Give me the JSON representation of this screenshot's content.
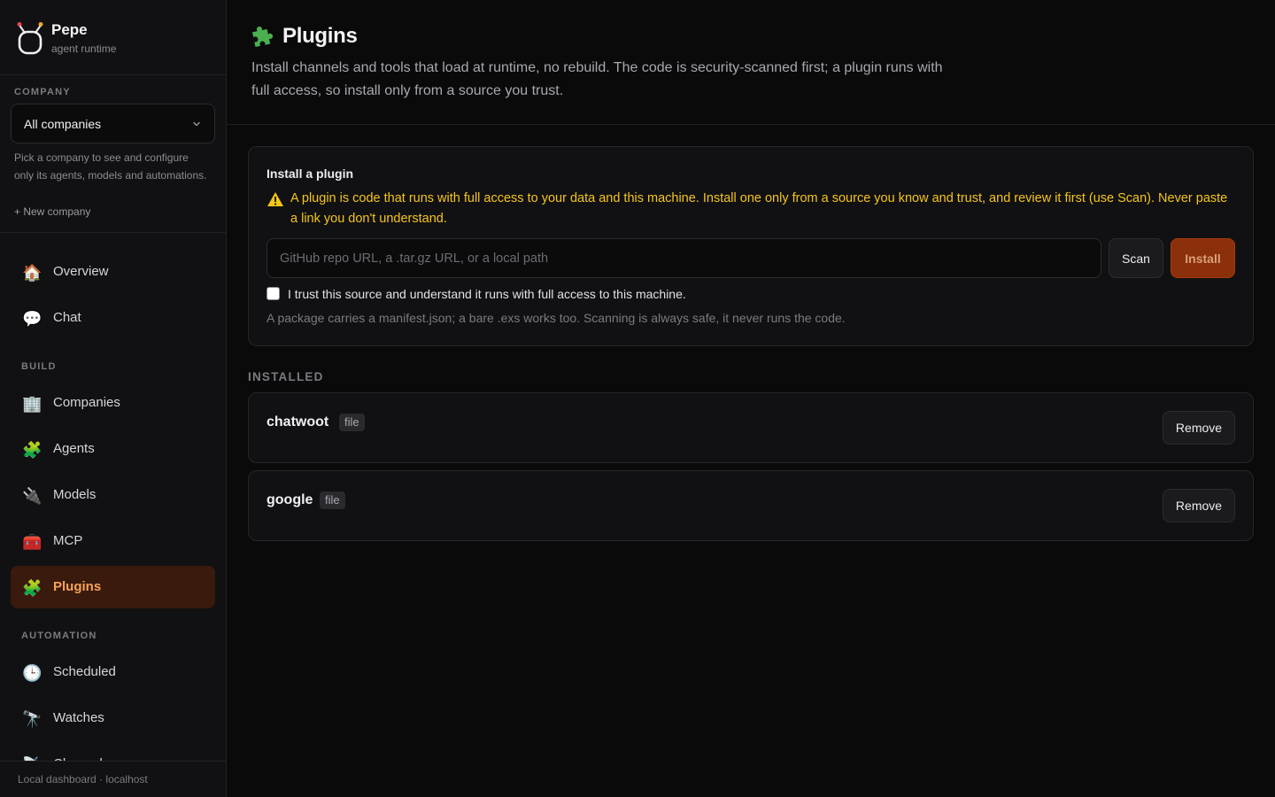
{
  "brand": {
    "name": "Pepe",
    "subtitle": "agent runtime",
    "icon": "tomato-logo-icon"
  },
  "company": {
    "section_label": "COMPANY",
    "selected": "All companies",
    "help": "Pick a company to see and configure only its agents, models and automations.",
    "new_company": "+ New company"
  },
  "nav": {
    "top": [
      {
        "label": "Overview",
        "icon": "house-icon",
        "glyph": "🏠"
      },
      {
        "label": "Chat",
        "icon": "speech-bubble-icon",
        "glyph": "💬"
      }
    ],
    "build_label": "BUILD",
    "build": [
      {
        "label": "Companies",
        "icon": "office-building-icon",
        "glyph": "🏢"
      },
      {
        "label": "Agents",
        "icon": "puzzle-piece-icon",
        "glyph": "🧩"
      },
      {
        "label": "Models",
        "icon": "plug-icon",
        "glyph": "🔌"
      },
      {
        "label": "MCP",
        "icon": "toolbox-icon",
        "glyph": "🧰"
      },
      {
        "label": "Plugins",
        "icon": "puzzle-piece-icon",
        "glyph": "🧩",
        "active": true
      }
    ],
    "automation_label": "AUTOMATION",
    "automation": [
      {
        "label": "Scheduled",
        "icon": "clock-icon",
        "glyph": "🕒"
      },
      {
        "label": "Watches",
        "icon": "telescope-icon",
        "glyph": "🔭"
      },
      {
        "label": "Channels",
        "icon": "satellite-icon",
        "glyph": "📡"
      }
    ]
  },
  "footer": {
    "text": "Local dashboard · localhost"
  },
  "page": {
    "title": "Plugins",
    "title_icon": "puzzle-piece-icon",
    "description": "Install channels and tools that load at runtime, no rebuild. The code is security-scanned first; a plugin runs with full access, so install only from a source you trust."
  },
  "install": {
    "title": "Install a plugin",
    "warning": "A plugin is code that runs with full access to your data and this machine. Install one only from a source you know and trust, and review it first (use Scan). Never paste a link you don't understand.",
    "input_value": "",
    "input_placeholder": "GitHub repo URL, a .tar.gz URL, or a local path",
    "scan_label": "Scan",
    "install_label": "Install",
    "trust_label": "I trust this source and understand it runs with full access to this machine.",
    "trust_checked": false,
    "help": "A package carries a manifest.json; a bare .exs works too. Scanning is always safe, it never runs the code."
  },
  "installed": {
    "label": "INSTALLED",
    "items": [
      {
        "name": "chatwoot",
        "tag": "file",
        "remove_label": "Remove"
      },
      {
        "name": "google",
        "tag": "file",
        "remove_label": "Remove"
      }
    ]
  },
  "colors": {
    "accent": "#f6a25a",
    "install_button": "#8c2f0b",
    "warning": "#f5c518",
    "background": "#0a0a0b"
  }
}
